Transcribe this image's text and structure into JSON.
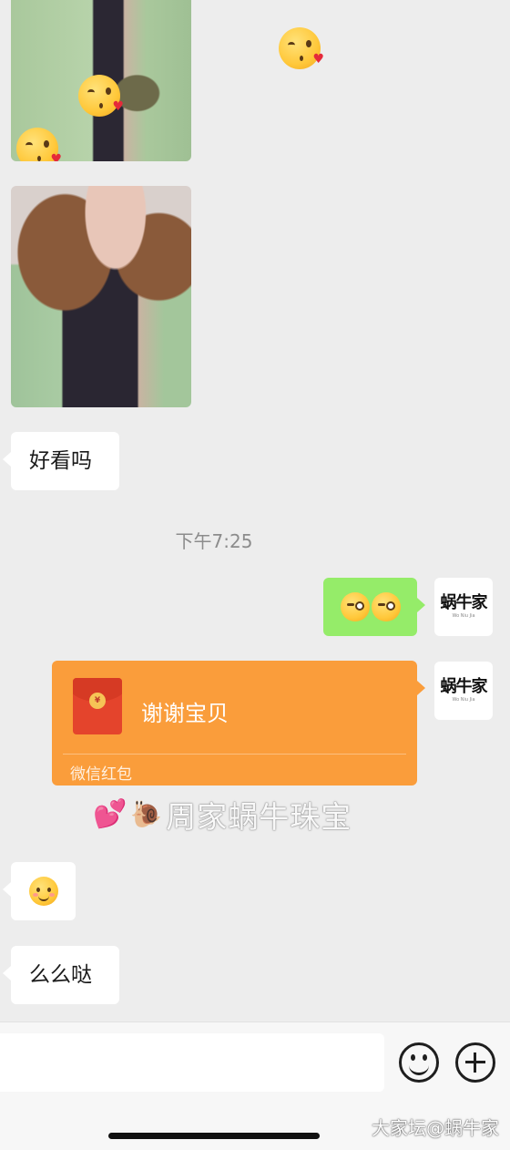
{
  "messages": {
    "text_1": "好看吗",
    "timestamp": "下午7:25",
    "text_2": "么么哒"
  },
  "avatar": {
    "logo": "蜗牛家",
    "tagline": "Wo Niu Jia"
  },
  "red_packet": {
    "title": "谢谢宝贝",
    "footer": "微信红包",
    "coin": "¥"
  },
  "watermark": {
    "hearts": "💕",
    "snail": "🐌",
    "text": "周家蜗牛珠宝",
    "site": "大家坛@蜗牛家"
  },
  "colors": {
    "background": "#ededed",
    "sent_bubble": "#95ec69",
    "red_packet": "#fa9d3b",
    "red_packet_icon": "#e4442c"
  },
  "icons": {
    "emoji_button": "smile-face-icon",
    "more_button": "plus-circle-icon",
    "kiss": "face-blowing-kiss-icon",
    "wink": "winking-face-icon",
    "smile": "smiling-face-icon"
  }
}
